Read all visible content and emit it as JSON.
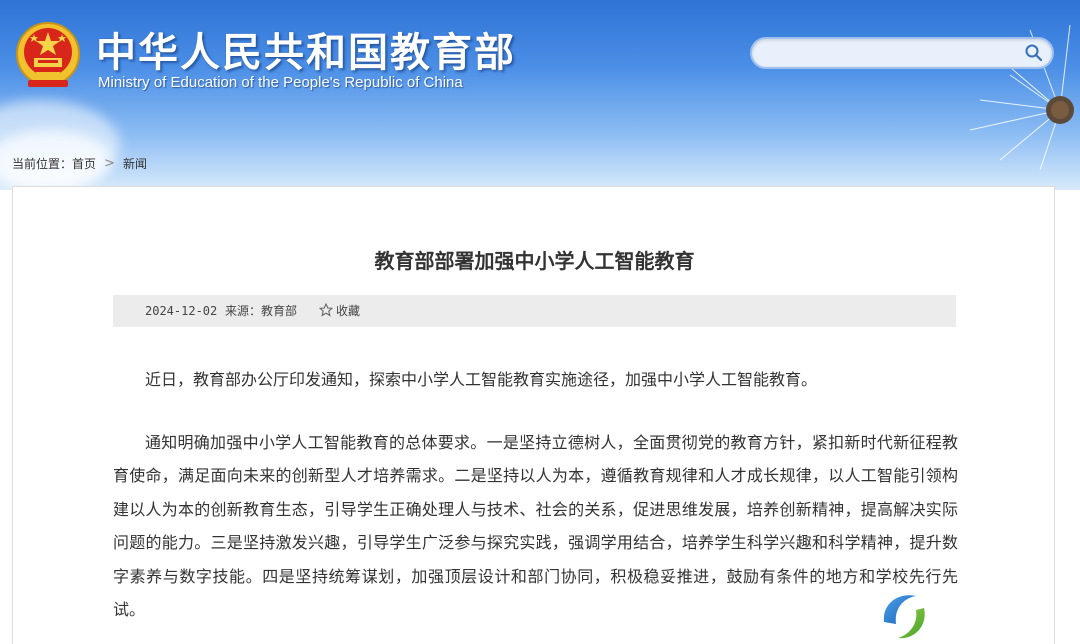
{
  "header": {
    "title_cn": "中华人民共和国教育部",
    "title_en": "Ministry of Education of the People's Republic of China",
    "emblem_icon": "national-emblem-icon",
    "search": {
      "value": "",
      "placeholder": "",
      "icon": "search-icon"
    }
  },
  "breadcrumb": {
    "prefix": "当前位置：",
    "items": [
      "首页",
      "新闻"
    ],
    "separator": ">"
  },
  "article": {
    "title": "教育部部署加强中小学人工智能教育",
    "date": "2024-12-02",
    "source": "来源：教育部",
    "favorite_label": "收藏",
    "paragraphs": [
      "近日，教育部办公厅印发通知，探索中小学人工智能教育实施途径，加强中小学人工智能教育。",
      "通知明确加强中小学人工智能教育的总体要求。一是坚持立德树人，全面贯彻党的教育方针，紧扣新时代新征程教育使命，满足面向未来的创新型人才培养需求。二是坚持以人为本，遵循教育规律和人才成长规律，以人工智能引领构建以人为本的创新教育生态，引导学生正确处理人与技术、社会的关系，促进思维发展，培养创新精神，提高解决实际问题的能力。三是坚持激发兴趣，引导学生广泛参与探究实践，强调学用结合，培养学生科学兴趣和科学精神，提升数字素养与数字技能。四是坚持统筹谋划，加强顶层设计和部门协同，积极稳妥推进，鼓励有条件的地方和学校先行先试。"
    ]
  },
  "colors": {
    "header_top": "#2f74d6",
    "header_bottom": "#d8eafb",
    "text": "#333333",
    "meta_bar": "#ececec"
  }
}
